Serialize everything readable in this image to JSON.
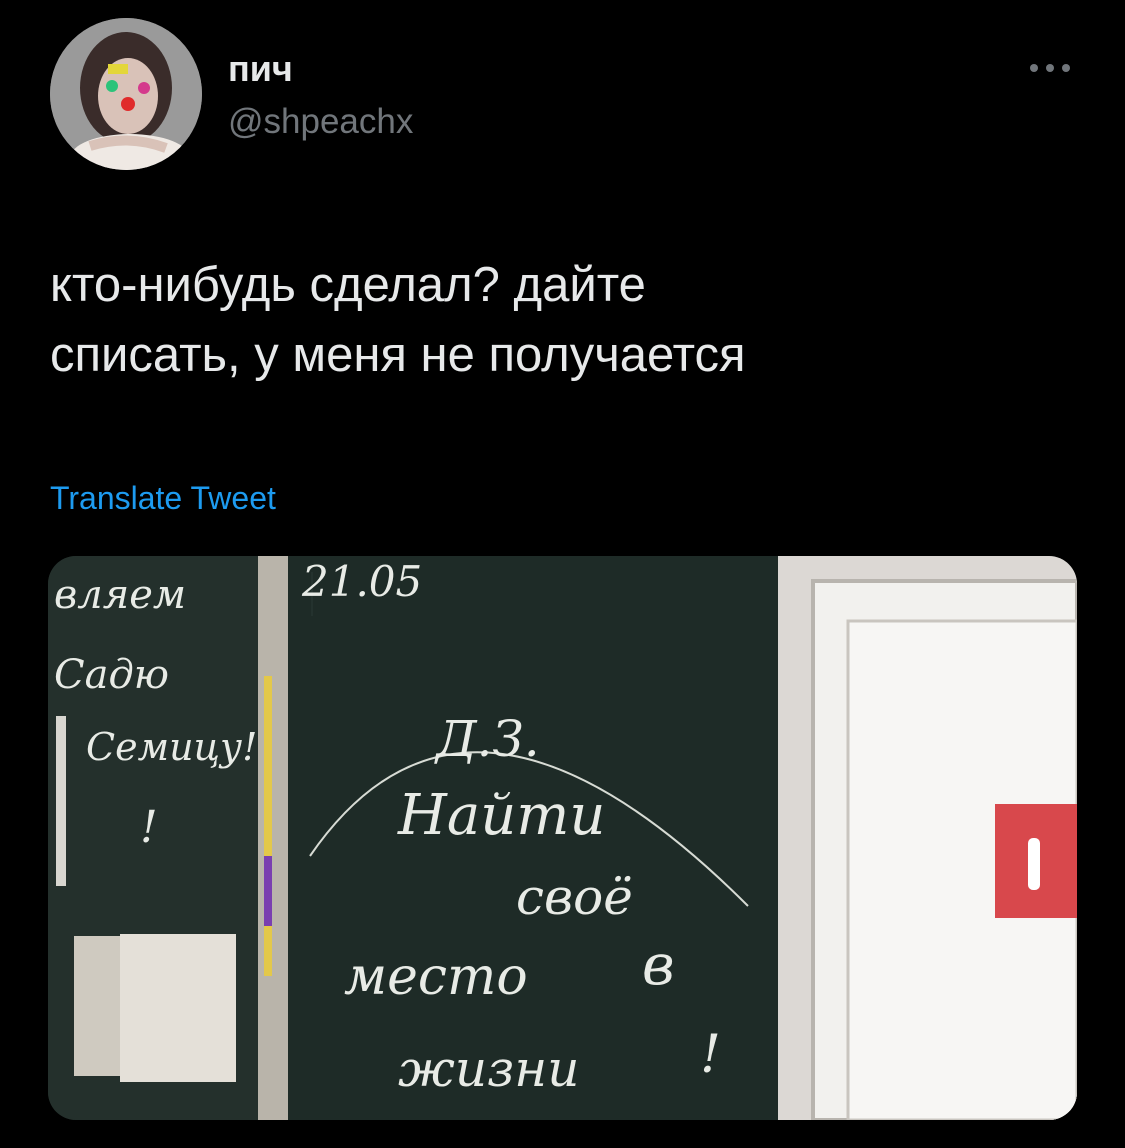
{
  "tweet": {
    "display_name": "пич",
    "handle": "@shpeachx",
    "text_lines": [
      "кто-нибудь сделал? дайте",
      "списать, у меня не получается"
    ],
    "translate_label": "Translate Tweet",
    "more_icon": "more-horizontal-icon",
    "avatar_icon": "user-avatar"
  },
  "image": {
    "left_board_lines": [
      "вляем",
      "Садю",
      "Семицу!",
      "!"
    ],
    "board_date": "21.05",
    "board_lines": [
      "Д.З.",
      "Найти",
      "своё",
      "место",
      "в",
      "жизни",
      "!"
    ]
  },
  "colors": {
    "background": "#000000",
    "text": "#e7e9ea",
    "secondary": "#71767b",
    "link": "#1d9bf0"
  }
}
